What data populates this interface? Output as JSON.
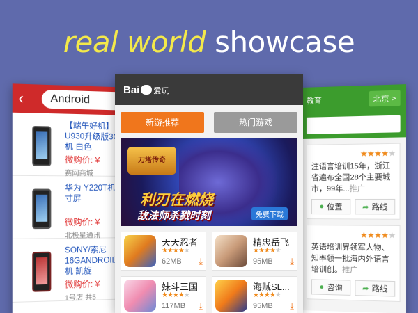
{
  "headline": {
    "word1": "real world",
    "word2": "showcase"
  },
  "left_screen": {
    "search_value": "Android",
    "products": [
      {
        "title": "【端午好机】U930升级版3G手机 白色",
        "price_label": "微购价: ¥",
        "shop": "赛网商城",
        "phone_color": "dark"
      },
      {
        "title": "华为 Y220T机 3.5寸屏",
        "price_label": "微购价: ¥",
        "shop": "北极星通讯",
        "phone_color": "dark"
      },
      {
        "title": "SONY/索尼16GANDROID手机 凯旋",
        "price_label": "微购价: ¥",
        "shop": "1号店   共5",
        "phone_color": "red"
      }
    ]
  },
  "mid_screen": {
    "brand": "Bai",
    "brand_suffix": "爱玩",
    "tabs": {
      "active": "新游推荐",
      "inactive": "热门游戏"
    },
    "banner": {
      "game_logo": "刀塔传奇",
      "line1": "利刃在燃烧",
      "line2": "敌法师杀戮时刻",
      "cta": "免费下载"
    },
    "games": [
      {
        "name": "天天忍者",
        "stars": 4,
        "size": "62MB"
      },
      {
        "name": "精忠岳飞",
        "stars": 4,
        "size": "95MB"
      },
      {
        "name": "妹斗三国",
        "stars": 4,
        "size": "117MB"
      },
      {
        "name": "海贼SL...",
        "stars": 4,
        "size": "95MB"
      }
    ]
  },
  "right_screen": {
    "logo": "教育",
    "city": "北京 >",
    "cards": [
      {
        "stars": 4,
        "text": "注语言培训15年，浙江省遍布全国28个主要城市，99年...",
        "more": "推广",
        "btn1": "位置",
        "btn2": "路线"
      },
      {
        "stars": 4,
        "text": "英语培训界领军人物、知率领一批海内外语言培训创。",
        "more": "推广",
        "btn1": "咨询",
        "btn2": "路线"
      }
    ]
  },
  "colors": {
    "background": "#5f6aac",
    "headline_yellow": "#f4e94a",
    "left_bar": "#cf2a2a",
    "tab_orange": "#f0761c",
    "right_bar": "#3c9c2d"
  }
}
